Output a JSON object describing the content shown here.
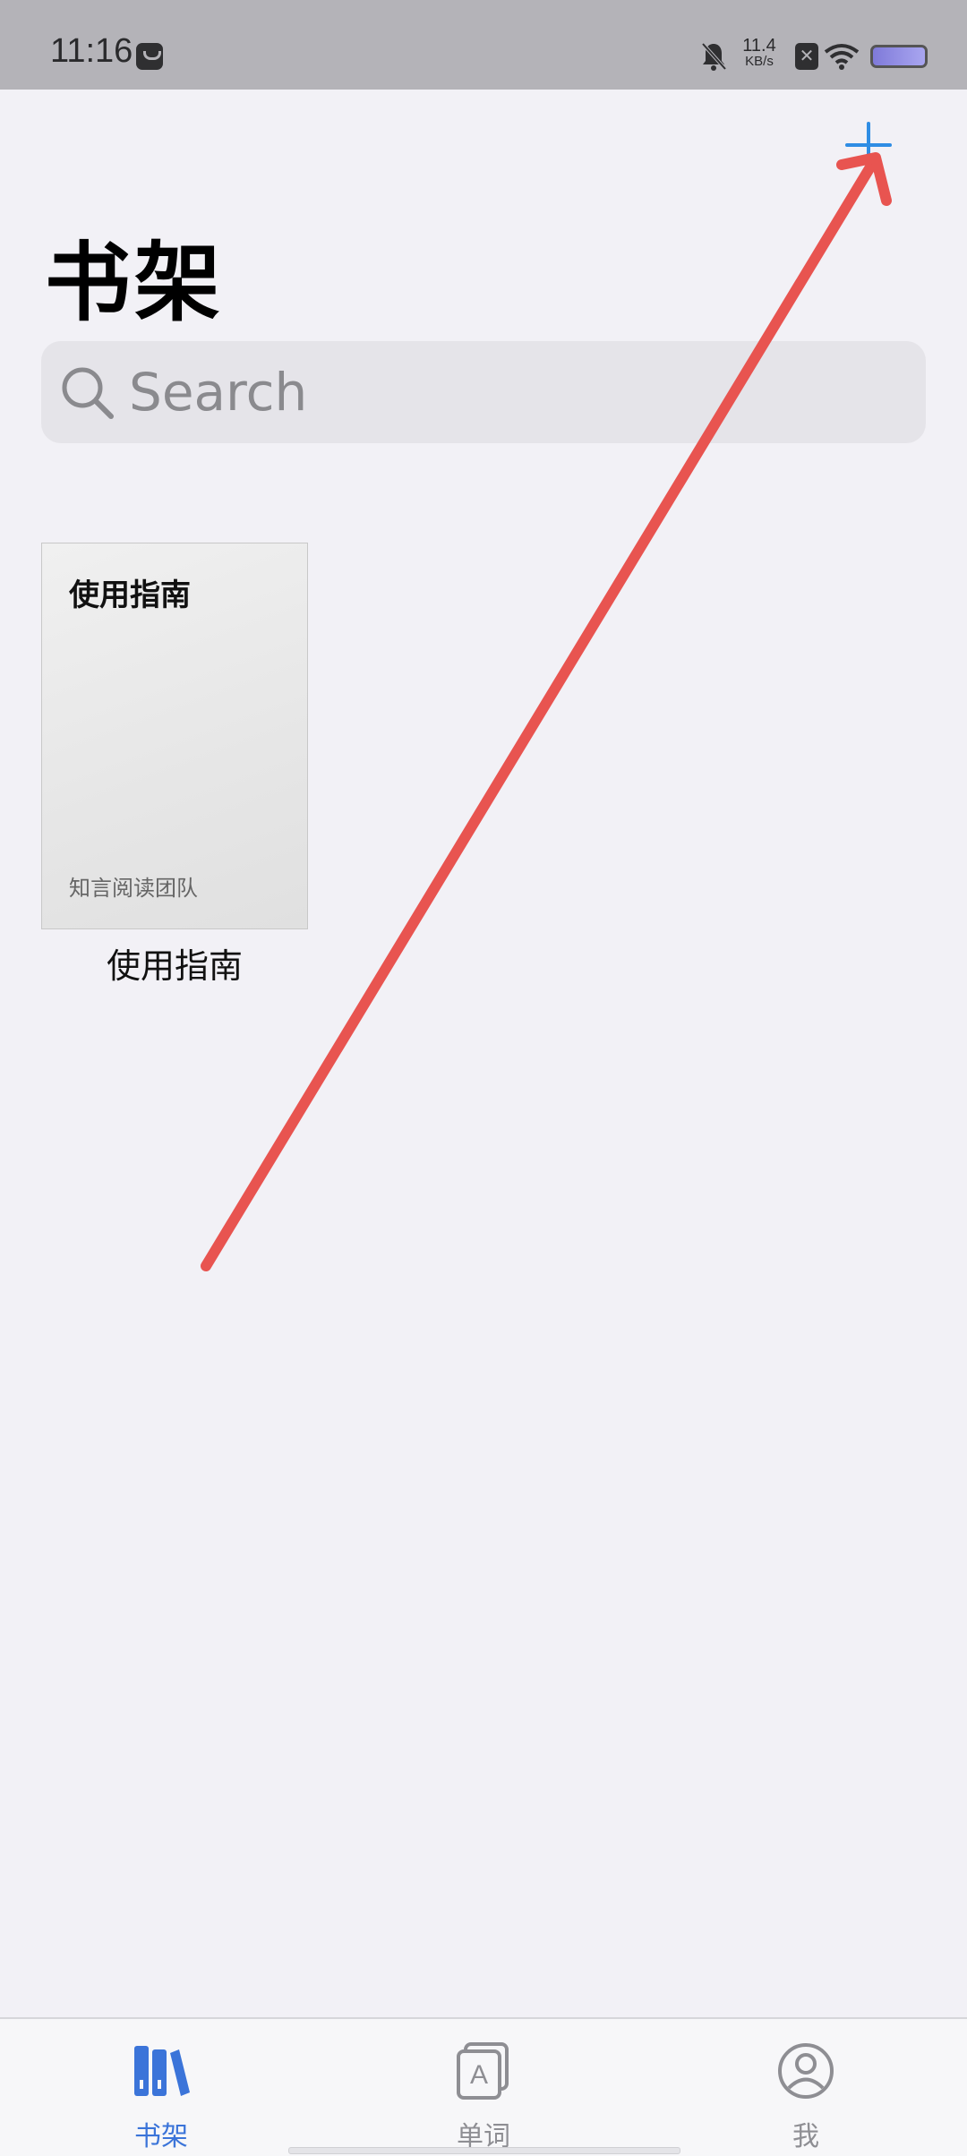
{
  "status_bar": {
    "time": "11:16",
    "net_speed_value": "11.4",
    "net_speed_unit": "KB/s",
    "icons": [
      "app-notification-icon",
      "bell-off-icon",
      "xbox-icon",
      "wifi-icon",
      "battery-icon"
    ]
  },
  "header": {
    "add_icon": "plus-icon",
    "accent_color": "#2f8de4",
    "title": "书架"
  },
  "search": {
    "placeholder": "Search"
  },
  "books": [
    {
      "cover_title": "使用指南",
      "cover_author": "知言阅读团队",
      "caption": "使用指南"
    }
  ],
  "annotation": {
    "type": "arrow",
    "color": "#e85450"
  },
  "tab_bar": {
    "active_color": "#3b74d9",
    "inactive_color": "#8e8e93",
    "tabs": [
      {
        "label": "书架",
        "icon": "bookshelf-icon",
        "active": true
      },
      {
        "label": "单词",
        "icon": "word-cards-icon",
        "active": false
      },
      {
        "label": "我",
        "icon": "profile-icon",
        "active": false
      }
    ]
  }
}
